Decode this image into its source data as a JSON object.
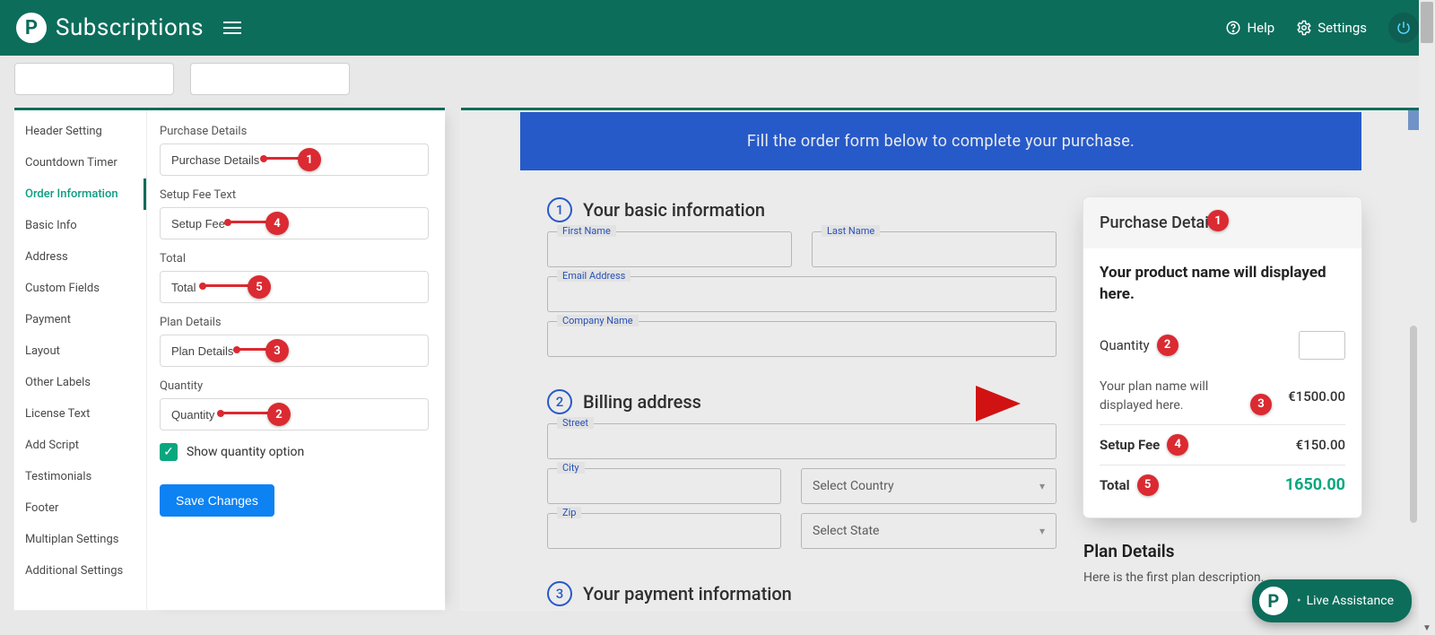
{
  "header": {
    "logo_letter": "P",
    "product": "Subscriptions",
    "help": "Help",
    "settings": "Settings"
  },
  "sidebar": {
    "items": [
      "Header Setting",
      "Countdown Timer",
      "Order Information",
      "Basic Info",
      "Address",
      "Custom Fields",
      "Payment",
      "Layout",
      "Other Labels",
      "License Text",
      "Add Script",
      "Testimonials",
      "Footer",
      "Multiplan Settings",
      "Additional Settings"
    ],
    "active_index": 2
  },
  "form": {
    "purchase_details_label": "Purchase Details",
    "purchase_details_value": "Purchase Details",
    "setup_fee_label": "Setup Fee Text",
    "setup_fee_value": "Setup Fee",
    "total_label": "Total",
    "total_value": "Total",
    "plan_details_label": "Plan Details",
    "plan_details_value": "Plan Details",
    "quantity_label": "Quantity",
    "quantity_value": "Quantity",
    "show_qty_label": "Show quantity option",
    "save": "Save Changes"
  },
  "annotations": {
    "n1": "1",
    "n2": "2",
    "n3": "3",
    "n4": "4",
    "n5": "5"
  },
  "preview": {
    "banner": "Fill the order form below to complete your purchase.",
    "sec1_num": "1",
    "sec1": "Your basic information",
    "sec2_num": "2",
    "sec2": "Billing address",
    "sec3_num": "3",
    "sec3": "Your payment information",
    "first_name": "First Name",
    "last_name": "Last Name",
    "email": "Email Address",
    "company": "Company Name",
    "street": "Street",
    "city": "City",
    "zip": "Zip",
    "country_ph": "Select Country",
    "state_ph": "Select State",
    "purchase_details": "Purchase Details",
    "product_name": "Your product name will displayed here.",
    "quantity": "Quantity",
    "plan_name_text": "Your plan name will displayed here.",
    "plan_price": "€1500.00",
    "setup_fee": "Setup Fee",
    "setup_fee_price": "€150.00",
    "total": "Total",
    "total_val": "1650.00",
    "plan_details_h": "Plan Details",
    "plan_details_desc": "Here is the first plan description."
  },
  "live": "Live Assistance"
}
